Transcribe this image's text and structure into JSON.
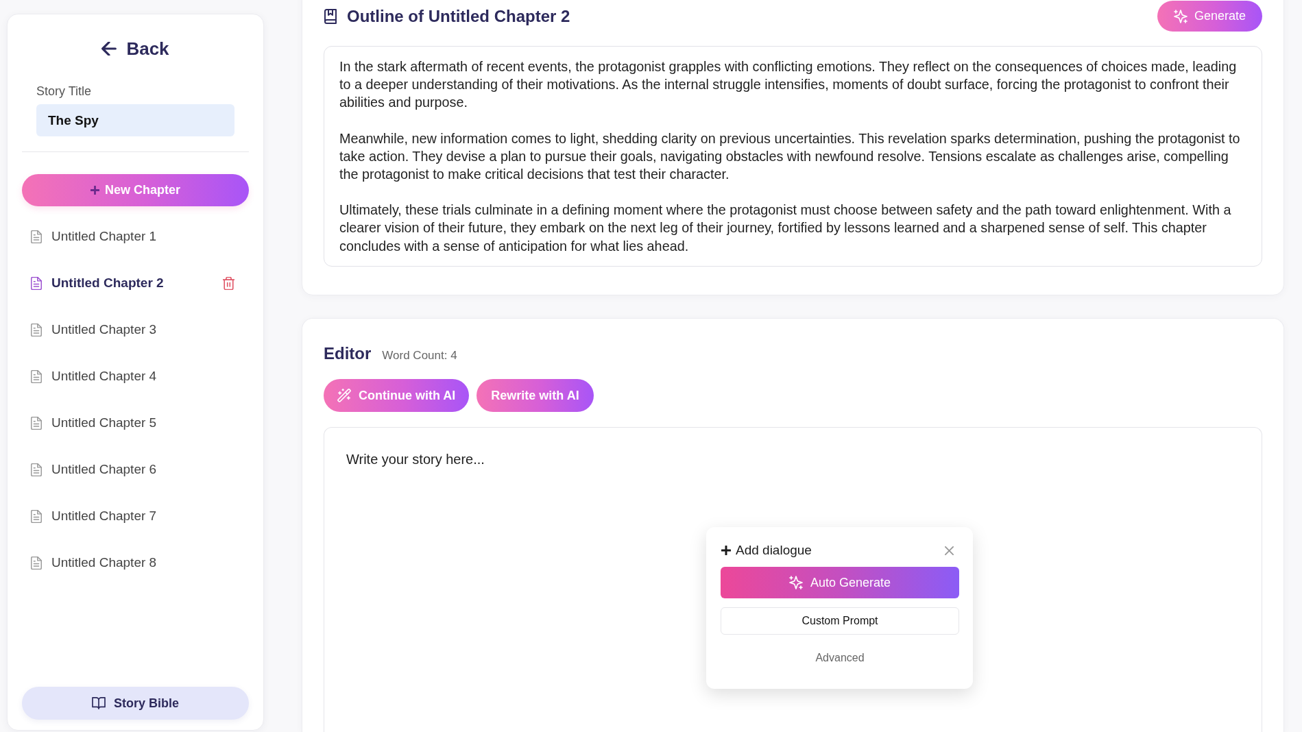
{
  "sidebar": {
    "back": "Back",
    "story_title": {
      "label": "Story Title",
      "value": "The Spy"
    },
    "new_chapter_button": "New Chapter",
    "chapters": [
      {
        "title": "Untitled Chapter 1",
        "selected": false
      },
      {
        "title": "Untitled Chapter 2",
        "selected": true
      },
      {
        "title": "Untitled Chapter 3",
        "selected": false
      },
      {
        "title": "Untitled Chapter 4",
        "selected": false
      },
      {
        "title": "Untitled Chapter 5",
        "selected": false
      },
      {
        "title": "Untitled Chapter 6",
        "selected": false
      },
      {
        "title": "Untitled Chapter 7",
        "selected": false
      },
      {
        "title": "Untitled Chapter 8",
        "selected": false
      }
    ],
    "story_bible_button": "Story Bible"
  },
  "outline": {
    "title": "Outline of Untitled Chapter 2",
    "generate_button": "Generate",
    "paragraphs": [
      "In the stark aftermath of recent events, the protagonist grapples with conflicting emotions. They reflect on the consequences of choices made, leading to a deeper understanding of their motivations. As the internal struggle intensifies, moments of doubt surface, forcing the protagonist to confront their abilities and purpose.",
      "Meanwhile, new information comes to light, shedding clarity on previous uncertainties. This revelation sparks determination, pushing the protagonist to take action. They devise a plan to pursue their goals, navigating obstacles with newfound resolve. Tensions escalate as challenges arise, compelling the protagonist to make critical decisions that test their character.",
      "Ultimately, these trials culminate in a defining moment where the protagonist must choose between safety and the path toward enlightenment. With a clearer vision of their future, they embark on the next leg of their journey, fortified by lessons learned and a sharpened sense of self. This chapter concludes with a sense of anticipation for what lies ahead."
    ]
  },
  "editor": {
    "title": "Editor",
    "word_count": "Word Count: 4",
    "continue_button": "Continue with AI",
    "rewrite_button": "Rewrite with AI",
    "content": "Write your story here..."
  },
  "dialogue_popup": {
    "title": "Add dialogue",
    "auto_generate_button": "Auto Generate",
    "custom_prompt_button": "Custom Prompt",
    "advanced_link": "Advanced"
  }
}
